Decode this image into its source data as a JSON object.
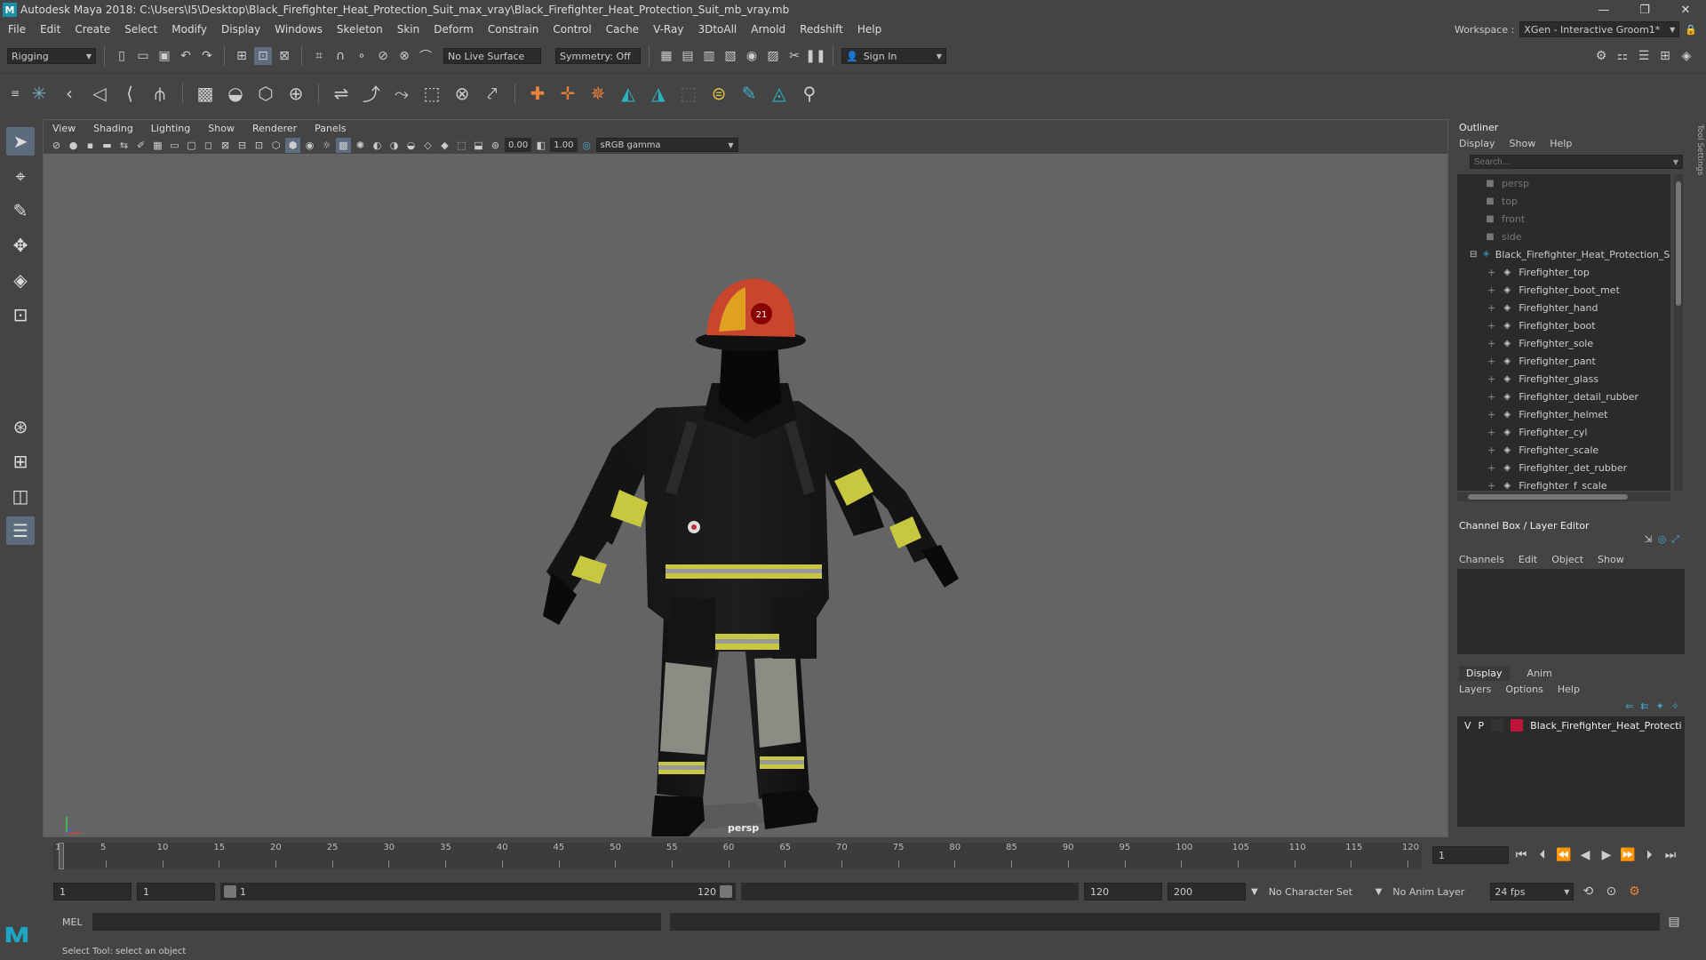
{
  "window": {
    "title": "Autodesk Maya 2018: C:\\Users\\I5\\Desktop\\Black_Firefighter_Heat_Protection_Suit_max_vray\\Black_Firefighter_Heat_Protection_Suit_mb_vray.mb",
    "logo": "M"
  },
  "menubar": [
    "File",
    "Edit",
    "Create",
    "Select",
    "Modify",
    "Display",
    "Windows",
    "Skeleton",
    "Skin",
    "Deform",
    "Constrain",
    "Control",
    "Cache",
    "V-Ray",
    "3DtoAll",
    "Arnold",
    "Redshift",
    "Help"
  ],
  "workspace": {
    "label": "Workspace :",
    "value": "XGen - Interactive Groom1*"
  },
  "statusline": {
    "mode": "Rigging",
    "live_surface": "No Live Surface",
    "symmetry": "Symmetry: Off",
    "sign_in": "Sign In"
  },
  "viewport": {
    "menu": [
      "View",
      "Shading",
      "Lighting",
      "Show",
      "Renderer",
      "Panels"
    ],
    "exposure": "0.00",
    "gamma": "1.00",
    "color_space": "sRGB gamma",
    "camera_label": "persp",
    "helmet_number": "21"
  },
  "outliner": {
    "title": "Outliner",
    "menu": [
      "Display",
      "Show",
      "Help"
    ],
    "search_placeholder": "Search...",
    "cameras": [
      "persp",
      "top",
      "front",
      "side"
    ],
    "group": "Black_Firefighter_Heat_Protection_Suit",
    "children": [
      "Firefighter_top",
      "Firefighter_boot_met",
      "Firefighter_hand",
      "Firefighter_boot",
      "Firefighter_sole",
      "Firefighter_pant",
      "Firefighter_glass",
      "Firefighter_detail_rubber",
      "Firefighter_helmet",
      "Firefighter_cyl",
      "Firefighter_scale",
      "Firefighter_det_rubber",
      "Firefighter_f_scale"
    ]
  },
  "channelbox": {
    "title": "Channel Box / Layer Editor",
    "menu": [
      "Channels",
      "Edit",
      "Object",
      "Show"
    ]
  },
  "layer_editor": {
    "tabs": [
      "Display",
      "Anim"
    ],
    "menu": [
      "Layers",
      "Options",
      "Help"
    ],
    "layer": {
      "v": "V",
      "p": "P",
      "name": "Black_Firefighter_Heat_Protecti",
      "color": "#c0143c"
    }
  },
  "timeline": {
    "ticks": [
      "1",
      "5",
      "10",
      "15",
      "20",
      "25",
      "30",
      "35",
      "40",
      "45",
      "50",
      "55",
      "60",
      "65",
      "70",
      "75",
      "80",
      "85",
      "90",
      "95",
      "100",
      "105",
      "110",
      "115",
      "120"
    ],
    "current_frame": "1"
  },
  "range": {
    "start": "1",
    "playback_start": "1",
    "range_start": "1",
    "range_end": "120",
    "playback_end": "120",
    "end": "200",
    "character_set": "No Character Set",
    "anim_layer": "No Anim Layer",
    "fps": "24 fps"
  },
  "command": {
    "label": "MEL"
  },
  "help": {
    "text": "Select Tool: select an object"
  },
  "side_tab": "Tool Settings"
}
